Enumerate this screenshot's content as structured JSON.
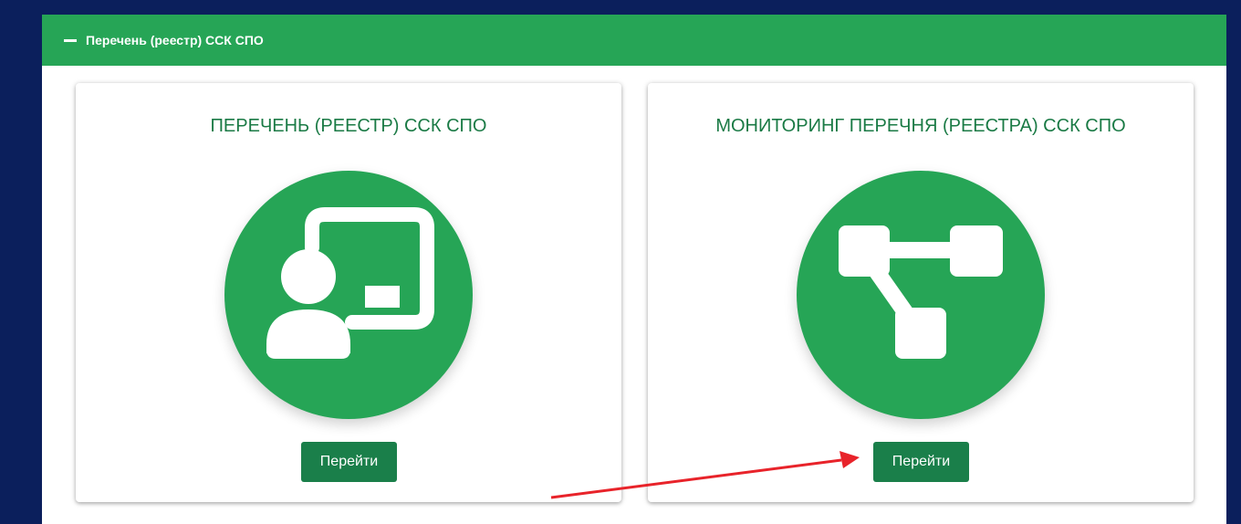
{
  "panel": {
    "title": "Перечень (реестр) ССК СПО",
    "collapse_icon": "minus-icon",
    "header_color": "#26a556"
  },
  "cards": [
    {
      "title": "ПЕРЕЧЕНЬ (РЕЕСТР) ССК СПО",
      "icon": "teacher-board-icon",
      "button_label": "Перейти"
    },
    {
      "title": "МОНИТОРИНГ ПЕРЕЧНЯ (РЕЕСТРА) ССК СПО",
      "icon": "flowchart-icon",
      "button_label": "Перейти"
    }
  ],
  "colors": {
    "background": "#0b1f5c",
    "accent_green": "#26a556",
    "button_green": "#1a7f4a",
    "title_green": "#1a7a45",
    "annotation_arrow": "#e8232a"
  }
}
